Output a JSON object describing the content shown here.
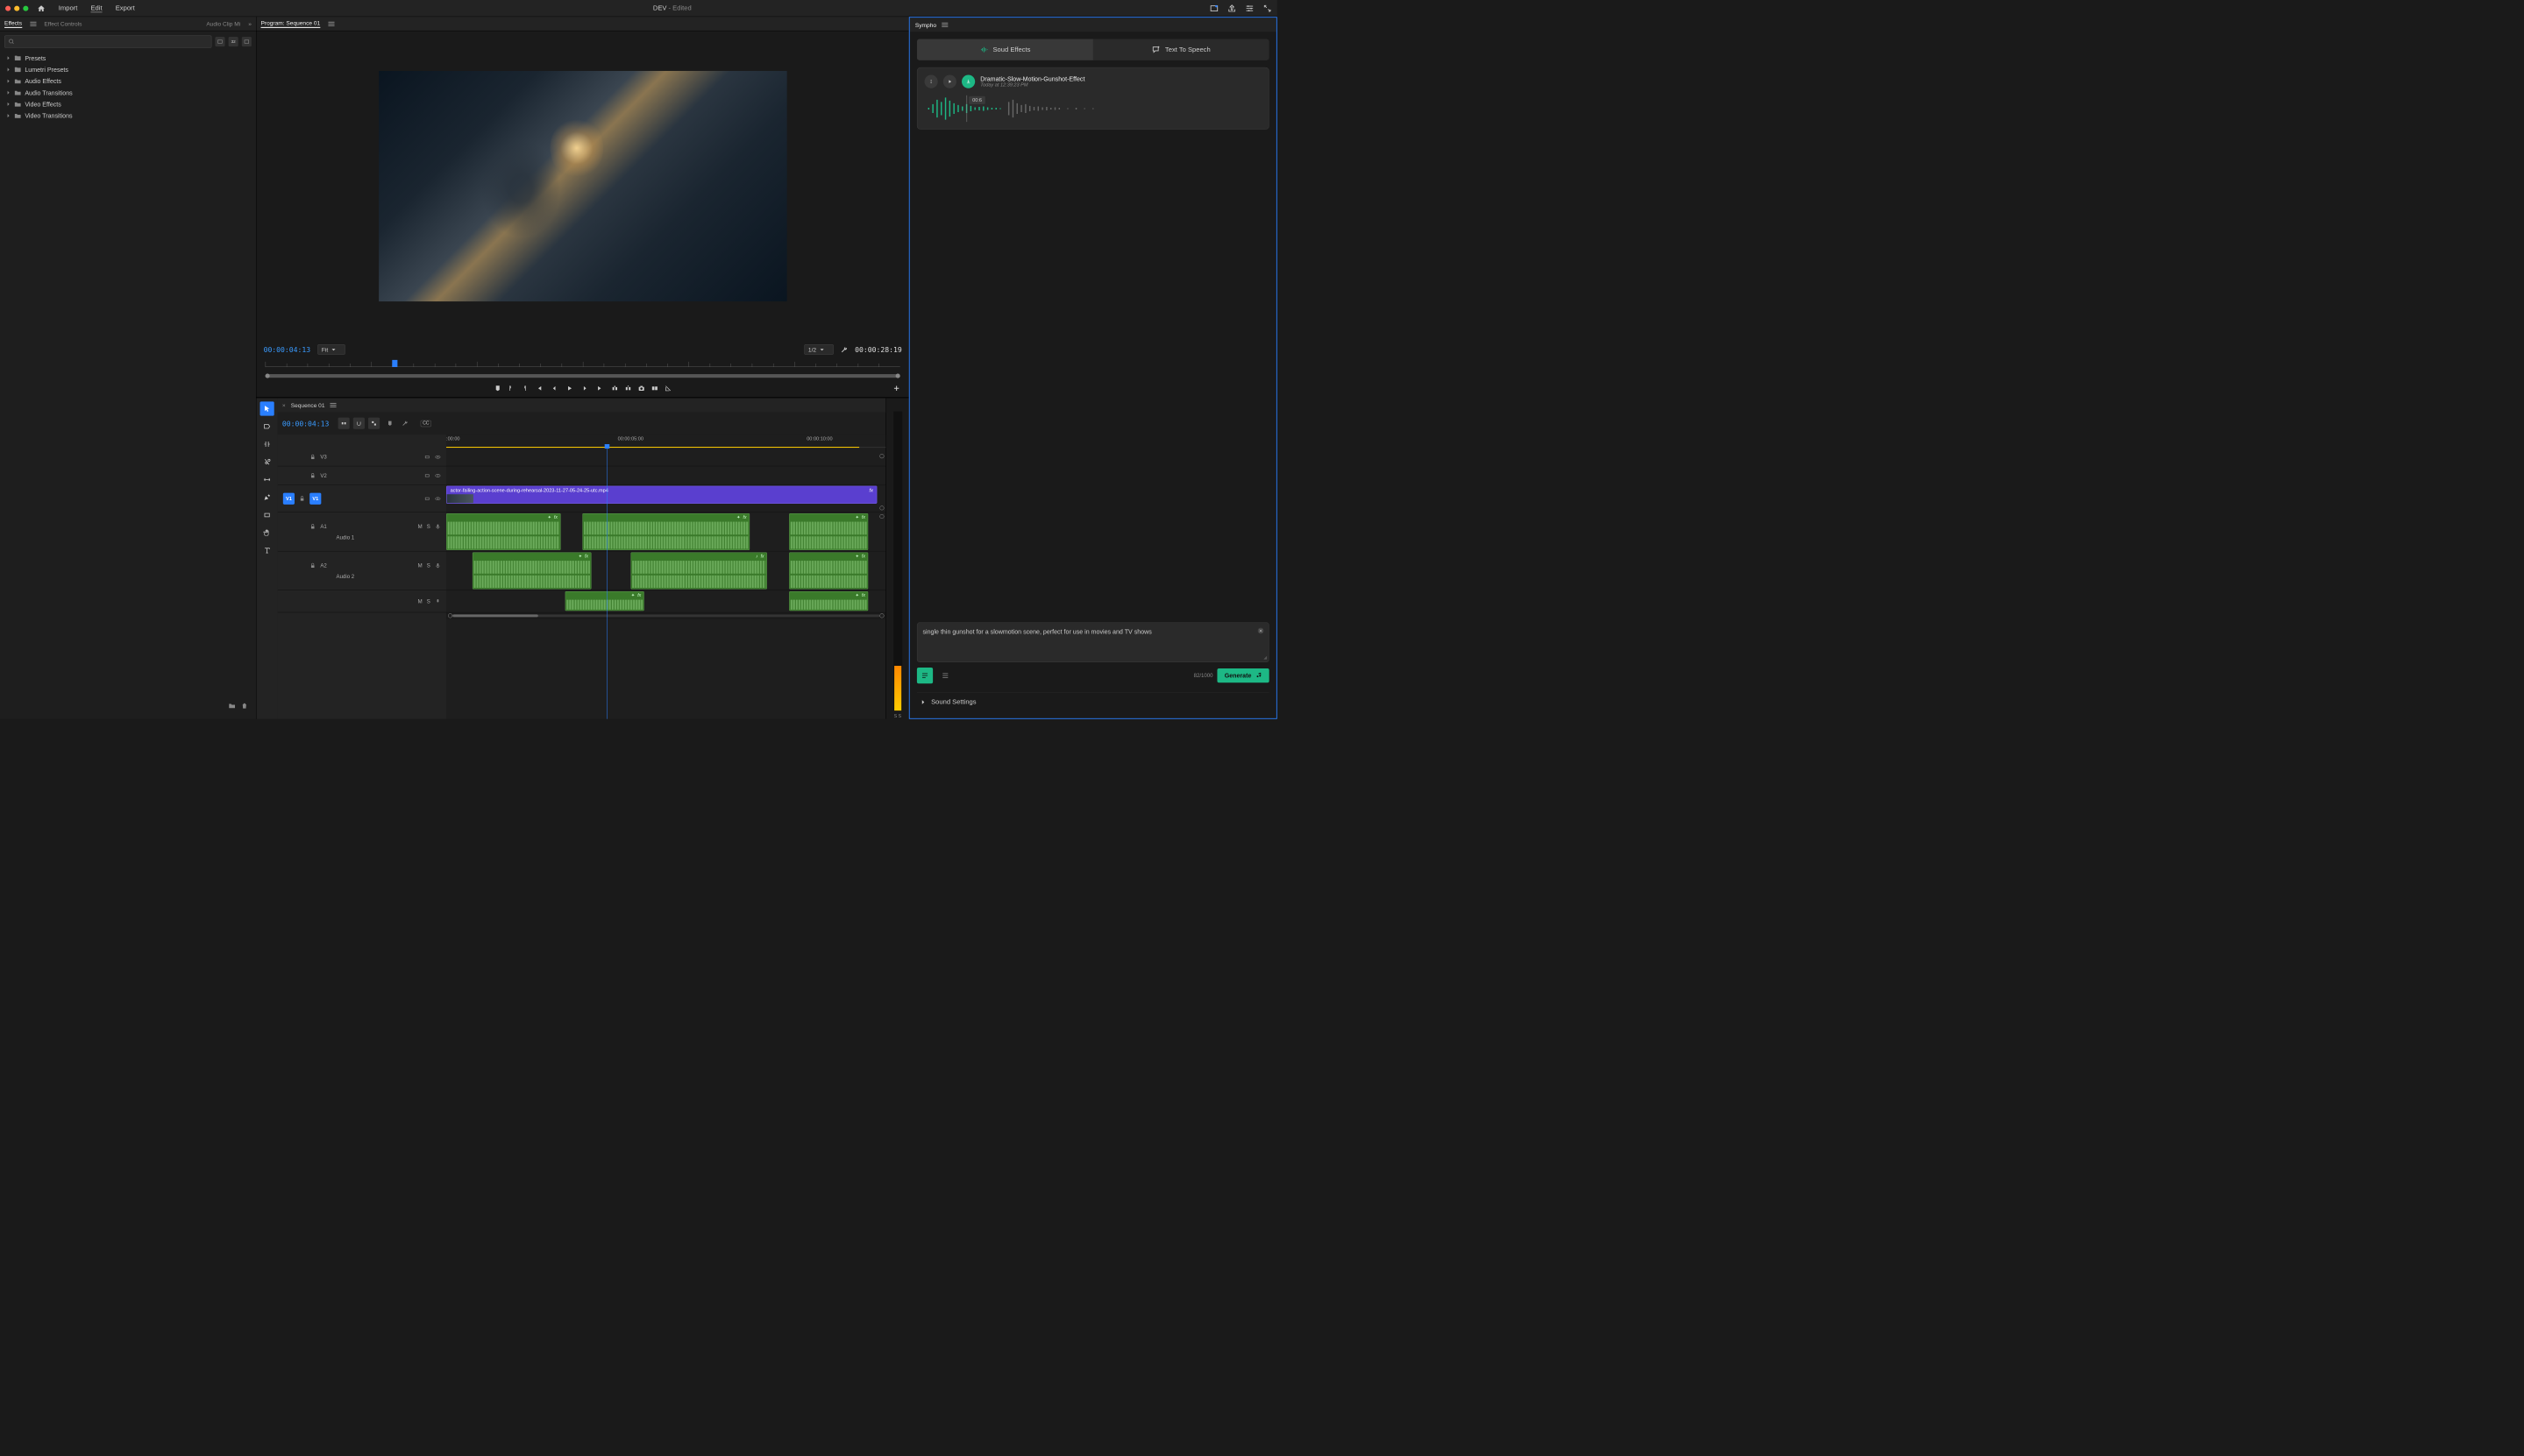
{
  "topbar": {
    "menu": {
      "import": "Import",
      "edit": "Edit",
      "export": "Export"
    },
    "title": "DEV",
    "title_suffix": " - Edited"
  },
  "panels": {
    "left_tabs": {
      "effects": "Effects",
      "effect_controls": "Effect Controls",
      "audio_clip": "Audio Clip Mi"
    },
    "program_tab": "Program: Sequence 01",
    "sympho_tab": "Sympho"
  },
  "effects": {
    "badges": [
      "",
      "32",
      ""
    ],
    "tree": [
      {
        "label": "Presets"
      },
      {
        "label": "Lumetri Presets"
      },
      {
        "label": "Audio Effects"
      },
      {
        "label": "Audio Transitions"
      },
      {
        "label": "Video Effects"
      },
      {
        "label": "Video Transitions"
      }
    ]
  },
  "program": {
    "timecode_left": "00:00:04:13",
    "fit_label": "Fit",
    "scale_label": "1/2",
    "timecode_right": "00:00:28:19"
  },
  "timeline": {
    "sequence_tab": "Sequence 01",
    "timecode": "00:00:04:13",
    "ruler_labels": [
      {
        "text": ":00:00",
        "left": "0%"
      },
      {
        "text": "00:00:05:00",
        "left": "39%"
      },
      {
        "text": "00:00:10:00",
        "left": "82%"
      }
    ],
    "tracks": {
      "v3": "V3",
      "v2": "V2",
      "v1": "V1",
      "a1": "A1",
      "audio1": "Audio 1",
      "a2": "A2",
      "audio2": "Audio 2",
      "m": "M",
      "s": "S"
    },
    "video_clip": {
      "label": "actor-failing-action-scene-during-rehearsal-2023-11-27-05-24-25-utc.mp4",
      "fx": "fx"
    },
    "meter_labels": "S  S"
  },
  "sympho": {
    "mode_sound": "Soud Effects",
    "mode_tts": "Text To Speech",
    "result": {
      "title": "Dramatic-Slow-Motion-Gunshot-Effect",
      "subtitle": "Today at 12:39:23 PM",
      "badge": "00:6"
    },
    "prompt_text": "single thin gunshot for a slowmotion scene, perfect for use in movies and TV shows",
    "char_count": "82/1000",
    "generate": "Generate",
    "settings": "Sound Settings"
  }
}
